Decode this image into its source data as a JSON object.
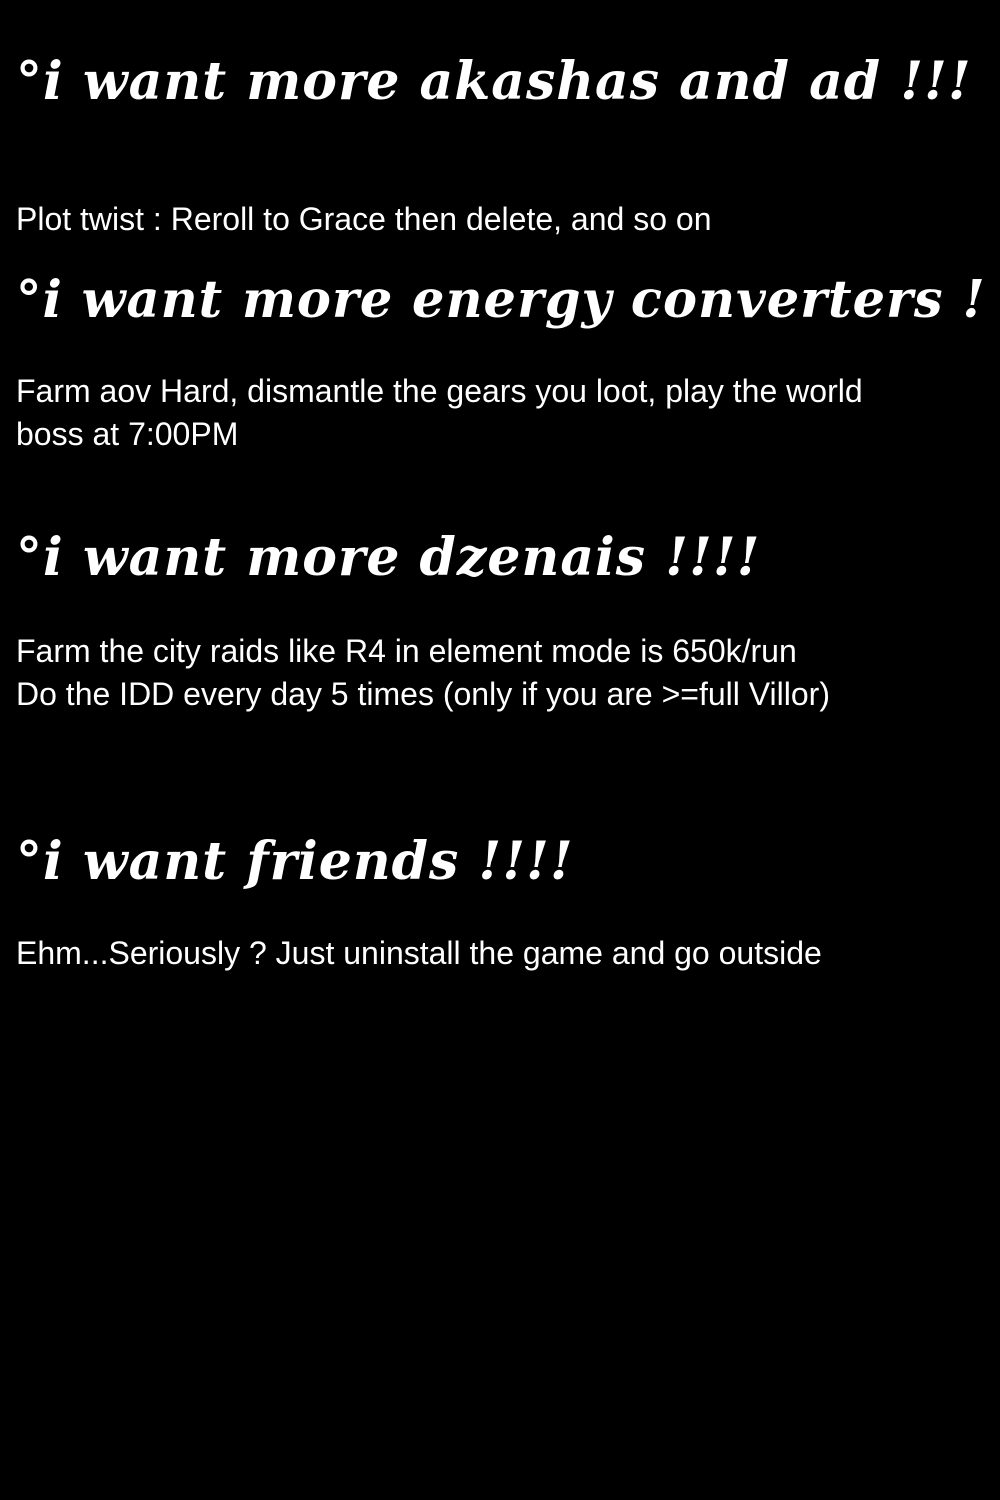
{
  "sections": [
    {
      "heading": "°i want more akashas and ad !!!",
      "lines": [
        "Plot twist : Reroll to Grace then delete, and so on"
      ]
    },
    {
      "heading": "°i want more energy converters !",
      "lines": [
        "Farm aov Hard, dismantle the gears you loot, play the world",
        "boss at 7:00PM"
      ]
    },
    {
      "heading": "°i want more dzenais !!!!",
      "lines": [
        "Farm the city raids like R4 in element mode is 650k/run",
        "Do the IDD every day 5 times (only if you are >=full Villor)"
      ]
    },
    {
      "heading": "°i want friends !!!!",
      "lines": [
        "Ehm...Seriously ? Just uninstall the game and go outside"
      ]
    }
  ],
  "colors": {
    "background": "#000000",
    "text": "#ffffff"
  }
}
